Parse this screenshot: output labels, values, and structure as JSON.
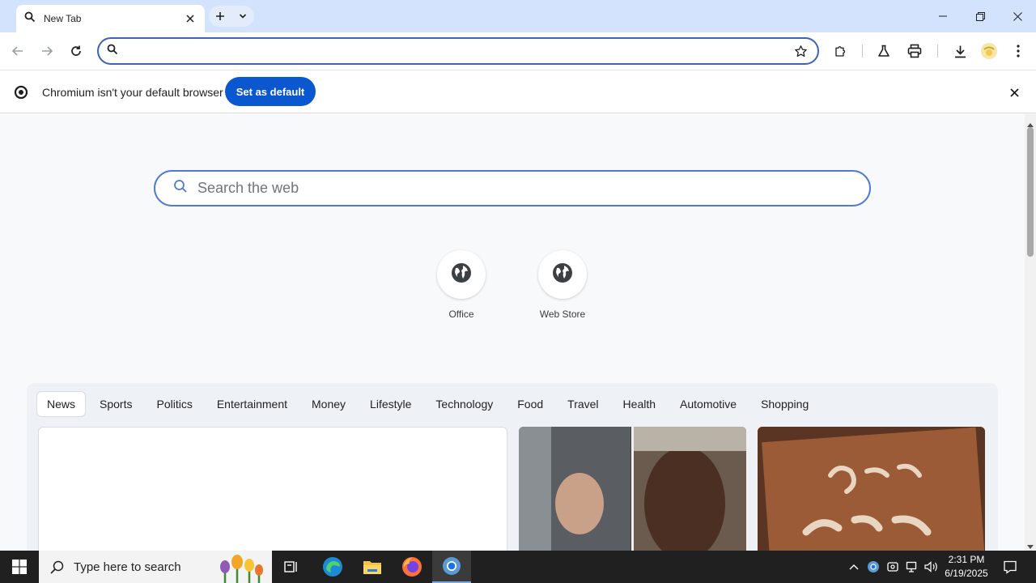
{
  "tab": {
    "title": "New Tab"
  },
  "omnibox": {
    "value": "",
    "placeholder": ""
  },
  "infobar": {
    "message": "Chromium isn't your default browser",
    "button_label": "Set as default"
  },
  "search": {
    "placeholder": "Search the web"
  },
  "shortcuts": [
    {
      "label": "Office",
      "icon": "globe-icon"
    },
    {
      "label": "Web Store",
      "icon": "globe-icon"
    }
  ],
  "feed": {
    "categories": [
      "News",
      "Sports",
      "Politics",
      "Entertainment",
      "Money",
      "Lifestyle",
      "Technology",
      "Food",
      "Travel",
      "Health",
      "Automotive",
      "Shopping"
    ],
    "active_category": "News"
  },
  "taskbar": {
    "search_placeholder": "Type here to search",
    "time": "2:31 PM",
    "date": "6/19/2025"
  },
  "colors": {
    "titlebar": "#d3e3fd",
    "accent": "#0b57d0",
    "omnibox_border": "#3d64b4",
    "taskbar": "#202020"
  }
}
